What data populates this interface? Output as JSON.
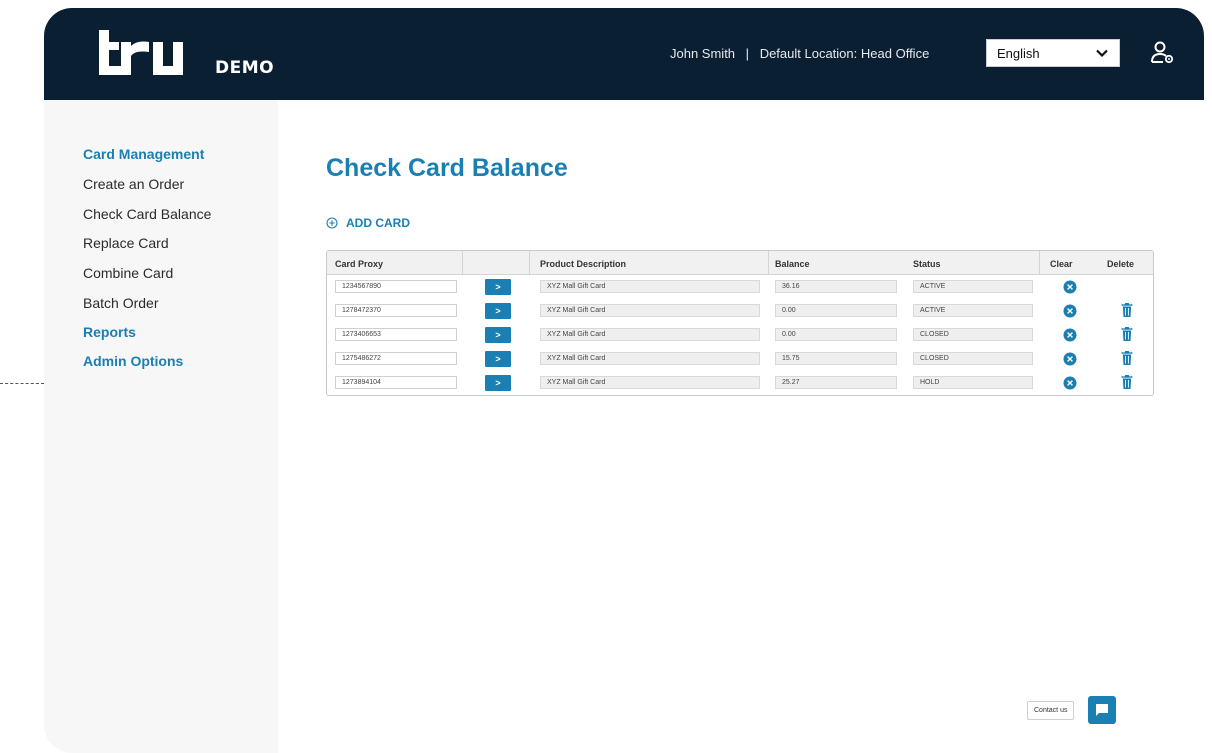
{
  "brand": {
    "logo_text": "tru",
    "demo_label": "DEMO"
  },
  "header": {
    "user_name": "John Smith",
    "separator": "|",
    "location_label": "Default Location:",
    "location_value": "Head Office",
    "language": {
      "selected": "English"
    },
    "icons": {
      "language_chevron": "chevron-down-icon",
      "account": "user-settings-icon"
    }
  },
  "sidebar": {
    "items": [
      {
        "label": "Card Management",
        "kind": "section"
      },
      {
        "label": "Create an Order",
        "kind": "link"
      },
      {
        "label": "Check Card Balance",
        "kind": "link"
      },
      {
        "label": "Replace Card",
        "kind": "link"
      },
      {
        "label": "Combine Card",
        "kind": "link"
      },
      {
        "label": "Batch Order",
        "kind": "link"
      },
      {
        "label": "Reports",
        "kind": "section"
      },
      {
        "label": "Admin Options",
        "kind": "section"
      }
    ]
  },
  "main": {
    "title": "Check Card Balance",
    "add_card_label": "ADD CARD",
    "table": {
      "columns": [
        "Card Proxy",
        "",
        "Product Description",
        "Balance",
        "Status",
        "Clear",
        "Delete"
      ],
      "go_label": ">",
      "rows": [
        {
          "proxy": "1234567890",
          "description": "XYZ Mall Gift Card",
          "balance": "36.16",
          "status": "ACTIVE",
          "has_delete": false
        },
        {
          "proxy": "1278472370",
          "description": "XYZ Mall Gift Card",
          "balance": "0.00",
          "status": "ACTIVE",
          "has_delete": true
        },
        {
          "proxy": "1273406653",
          "description": "XYZ Mall Gift Card",
          "balance": "0.00",
          "status": "CLOSED",
          "has_delete": true
        },
        {
          "proxy": "1275486272",
          "description": "XYZ Mall Gift Card",
          "balance": "15.75",
          "status": "CLOSED",
          "has_delete": true
        },
        {
          "proxy": "1273894104",
          "description": "XYZ Mall Gift Card",
          "balance": "25.27",
          "status": "HOLD",
          "has_delete": true
        }
      ]
    }
  },
  "footer": {
    "contact_label": "Contact us",
    "chat_icon": "chat-icon"
  },
  "colors": {
    "header_bg": "#0b1f33",
    "accent": "#1a7fb2",
    "sidebar_bg": "#f7f7f7"
  }
}
